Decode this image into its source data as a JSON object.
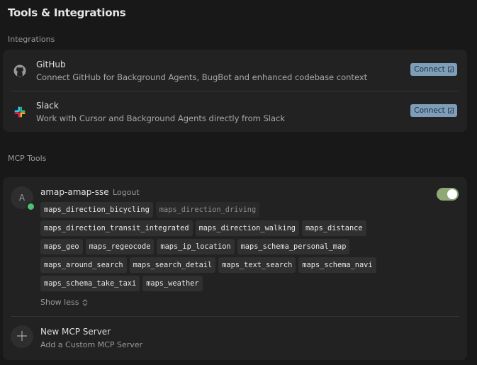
{
  "page": {
    "title": "Tools & Integrations"
  },
  "integrations": {
    "section_label": "Integrations",
    "items": [
      {
        "name": "GitHub",
        "description": "Connect GitHub for Background Agents, BugBot and enhanced codebase context",
        "button": "Connect",
        "icon": "github-icon"
      },
      {
        "name": "Slack",
        "description": "Work with Cursor and Background Agents directly from Slack",
        "button": "Connect",
        "icon": "slack-icon"
      }
    ]
  },
  "mcp": {
    "section_label": "MCP Tools",
    "server": {
      "avatar_letter": "A",
      "name": "amap-amap-sse",
      "logout_label": "Logout",
      "enabled": true,
      "tool_rows": [
        [
          {
            "name": "maps_direction_bicycling",
            "enabled": true
          },
          {
            "name": "maps_direction_driving",
            "enabled": false
          }
        ],
        [
          {
            "name": "maps_direction_transit_integrated",
            "enabled": true
          },
          {
            "name": "maps_direction_walking",
            "enabled": true
          },
          {
            "name": "maps_distance",
            "enabled": true
          }
        ],
        [
          {
            "name": "maps_geo",
            "enabled": true
          },
          {
            "name": "maps_regeocode",
            "enabled": true
          },
          {
            "name": "maps_ip_location",
            "enabled": true
          },
          {
            "name": "maps_schema_personal_map",
            "enabled": true
          }
        ],
        [
          {
            "name": "maps_around_search",
            "enabled": true
          },
          {
            "name": "maps_search_detail",
            "enabled": true
          },
          {
            "name": "maps_text_search",
            "enabled": true
          },
          {
            "name": "maps_schema_navi",
            "enabled": true
          }
        ],
        [
          {
            "name": "maps_schema_take_taxi",
            "enabled": true
          },
          {
            "name": "maps_weather",
            "enabled": true
          }
        ]
      ],
      "show_less_label": "Show less"
    },
    "new_server": {
      "title": "New MCP Server",
      "subtitle": "Add a Custom MCP Server"
    }
  },
  "colors": {
    "background": "#181818",
    "card": "#222222",
    "connect_button": "#7e9db8",
    "toggle_on": "#8fa876",
    "status_online": "#4fbf74"
  }
}
